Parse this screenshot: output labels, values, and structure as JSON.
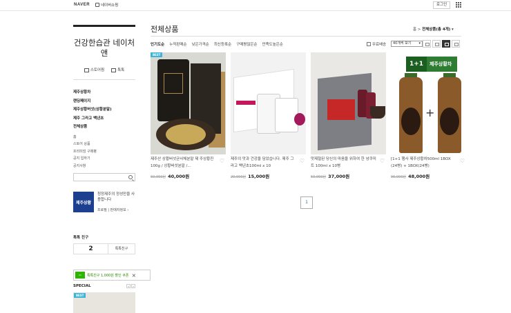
{
  "topbar": {
    "logo": "NAVER",
    "store_link": "네이버쇼핑",
    "login": "로그인"
  },
  "sidebar": {
    "shop_title": "건강한습관 네이처앤",
    "actions": [
      "스토어찜",
      "톡톡"
    ],
    "categories": [
      "제주상황차",
      "랜딩페이지",
      "제주상황버섯(상황분말)",
      "제주 그라고 백년초",
      "전체상품"
    ],
    "sub_links": [
      "홈",
      "스토어 상품",
      "프리미엄 구매평",
      "공지 입하기",
      "공지사항"
    ],
    "search_placeholder": "",
    "profile": {
      "image_text": "제주상황",
      "text": "청정제주의 정성만을 사용합니다",
      "links": "프로필 | 판매자정보 ›"
    },
    "talk_friends": {
      "title": "톡톡 친구",
      "count": "2",
      "button": "톡톡친구"
    },
    "coupon": "톡톡친구 1,000원 할인 쿠폰",
    "special": "SPECIAL",
    "special_badge": "BEST"
  },
  "main": {
    "title": "전체상품",
    "breadcrumb_home": "홈",
    "breadcrumb_current": "전체상품(총 4개)",
    "sort_options": [
      "인기도순",
      "누적판매순",
      "낮은가격순",
      "최신등록순",
      "구매평많은순",
      "만족도높은순"
    ],
    "free_shipping": "무료배송",
    "view_count": "40개씩 보기",
    "products": [
      {
        "badge": "BEST",
        "name": "제주산 상황버섯균사체분말 제 주상황진 100g / 상황버섯분말 /...",
        "old_price": "60,000원",
        "new_price": "40,000원"
      },
      {
        "badge": "",
        "name": "제주의 맛과 건강을 담았습니다. 제주 그라고 백년초100ml x 10",
        "old_price": "20,000원",
        "new_price": "15,000원"
      },
      {
        "badge": "",
        "name": "맛제철된 당신의 마음을 위하여 한 넝쿠미트 100ml x 10병",
        "old_price": "50,000원",
        "new_price": "37,000원"
      },
      {
        "badge": "",
        "name": "[1+1 행사 제주상황차500ml 1BOX (24병) + 1BOX(24병)",
        "old_price": "96,000원",
        "new_price": "48,000원",
        "banner": "1+1",
        "banner_text": "제주상황차"
      }
    ],
    "page": "1"
  },
  "colors": {
    "badge": "#3db5d8",
    "coupon_green": "#2db400",
    "pager_blue": "#2a6ab8"
  }
}
